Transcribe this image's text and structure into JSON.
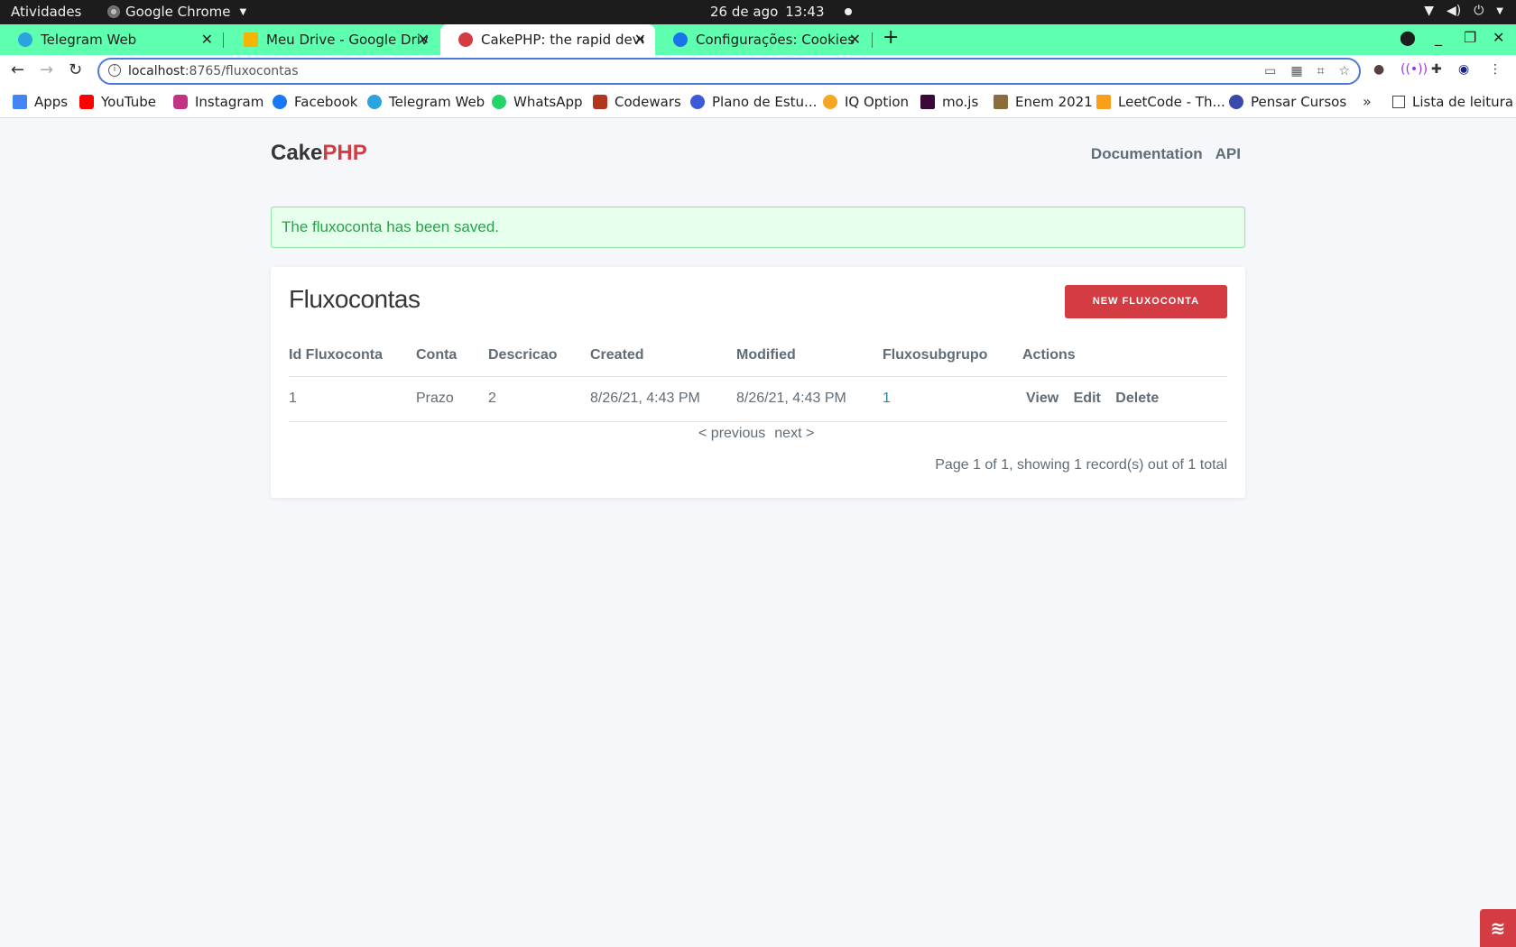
{
  "os_bar": {
    "activities": "Atividades",
    "app_name": "Google Chrome",
    "date": "26 de ago",
    "time": "13:43"
  },
  "tabs": [
    {
      "title": "Telegram Web",
      "icon": "telegram-icon",
      "color": "#2aa3df"
    },
    {
      "title": "Meu Drive - Google Drive",
      "icon": "drive-icon",
      "color": "#f4b400"
    },
    {
      "title": "CakePHP: the rapid develo",
      "icon": "cakephp-icon",
      "color": "#d33c43"
    },
    {
      "title": "Configurações: Cookies e",
      "icon": "gear-icon",
      "color": "#1a73e8"
    }
  ],
  "address_bar": {
    "host": "localhost",
    "path": ":8765/fluxocontas"
  },
  "bookmarks": [
    {
      "label": "Apps",
      "icon": "apps-grid-icon",
      "color": "#4285f4"
    },
    {
      "label": "YouTube",
      "icon": "youtube-icon",
      "color": "#ff0000"
    },
    {
      "label": "Instagram",
      "icon": "instagram-icon",
      "color": "#c13584"
    },
    {
      "label": "Facebook",
      "icon": "facebook-icon",
      "color": "#1877f2"
    },
    {
      "label": "Telegram Web",
      "icon": "telegram-icon",
      "color": "#2aa3df"
    },
    {
      "label": "WhatsApp",
      "icon": "whatsapp-icon",
      "color": "#25d366"
    },
    {
      "label": "Codewars",
      "icon": "codewars-icon",
      "color": "#b1361e"
    },
    {
      "label": "Plano de Estu...",
      "icon": "notion-icon",
      "color": "#3b5bdb"
    },
    {
      "label": "IQ Option",
      "icon": "iqoption-icon",
      "color": "#f5a623"
    },
    {
      "label": "mo.js",
      "icon": "mojs-icon",
      "color": "#3a0839"
    },
    {
      "label": "Enem 2021",
      "icon": "enem-icon",
      "color": "#8a6d3b"
    },
    {
      "label": "LeetCode - Th...",
      "icon": "leetcode-icon",
      "color": "#f89f1b"
    },
    {
      "label": "Pensar Cursos",
      "icon": "pensar-icon",
      "color": "#3949ab"
    }
  ],
  "reading_list": "Lista de leitura",
  "site": {
    "brand_cake": "Cake",
    "brand_php": "PHP",
    "nav": [
      "Documentation",
      "API"
    ]
  },
  "flash_message": "The fluxoconta has been saved.",
  "content": {
    "title": "Fluxocontas",
    "new_button": "NEW FLUXOCONTA",
    "columns": [
      "Id Fluxoconta",
      "Conta",
      "Descricao",
      "Created",
      "Modified",
      "Fluxosubgrupo",
      "Actions"
    ],
    "rows": [
      {
        "id": "1",
        "conta": "Prazo",
        "descricao": "2",
        "created": "8/26/21, 4:43 PM",
        "modified": "8/26/21, 4:43 PM",
        "fluxosubgrupo": "1",
        "actions": [
          "View",
          "Edit",
          "Delete"
        ]
      }
    ],
    "pager": {
      "previous": "< previous",
      "next": "next >"
    },
    "counter": "Page 1 of 1, showing 1 record(s) out of 1 total"
  },
  "colors": {
    "tab_strip": "#5effaf",
    "cake_red": "#d33c43",
    "flash_bg": "#e6ffed",
    "flash_text": "#2ca04a",
    "link": "#2f85ae"
  }
}
